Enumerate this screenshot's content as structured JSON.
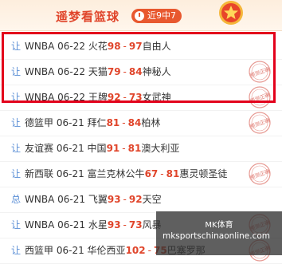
{
  "header": {
    "title": "遥梦看篮球",
    "record": "近9中7"
  },
  "rows": [
    {
      "icon": "让",
      "league": "WNBA",
      "date": "06-22",
      "home": "火花",
      "hs": "98",
      "as": "97",
      "away": "自由人",
      "stamp": false
    },
    {
      "icon": "让",
      "league": "WNBA",
      "date": "06-22",
      "home": "天猫",
      "hs": "79",
      "as": "84",
      "away": "神秘人",
      "stamp": true
    },
    {
      "icon": "让",
      "league": "WNBA",
      "date": "06-22",
      "home": "王牌",
      "hs": "92",
      "as": "73",
      "away": "女武神",
      "stamp": true
    },
    {
      "icon": "让",
      "league": "德篮甲",
      "date": "06-21",
      "home": "拜仁",
      "hs": "81",
      "as": "84",
      "away": "柏林",
      "stamp": true
    },
    {
      "icon": "让",
      "league": "友谊赛",
      "date": "06-21",
      "home": "中国",
      "hs": "91",
      "as": "81",
      "away": "澳大利亚",
      "stamp": false
    },
    {
      "icon": "让",
      "league": "新西联",
      "date": "06-21",
      "home": "富兰克林公牛",
      "hs": "67",
      "as": "81",
      "away": "惠灵顿圣徒",
      "stamp": true
    },
    {
      "icon": "总",
      "league": "WNBA",
      "date": "06-21",
      "home": "飞翼",
      "hs": "93",
      "as": "92",
      "away": "天空",
      "stamp": false
    },
    {
      "icon": "让",
      "league": "WNBA",
      "date": "06-21",
      "home": "水星",
      "hs": "93",
      "as": "73",
      "away": "风暴",
      "stamp": true
    },
    {
      "icon": "让",
      "league": "西篮甲",
      "date": "06-21",
      "home": "华伦西亚",
      "hs": "102",
      "as": "75",
      "away": "巴塞罗那",
      "stamp": true
    }
  ],
  "stamp_text": "预测正确",
  "watermark": {
    "line1": "MK体育",
    "line2": "mksportschinaonline.com"
  },
  "colors": {
    "accent": "#e0452b",
    "highlight": "#e3001b",
    "icon": "#5b8fd6"
  }
}
